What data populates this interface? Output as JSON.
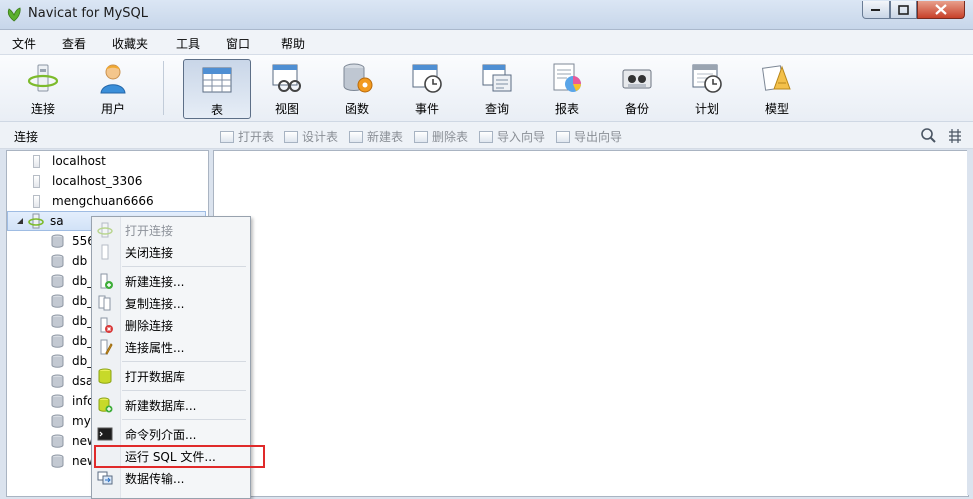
{
  "window": {
    "title": "Navicat for MySQL"
  },
  "menu": [
    "文件",
    "查看",
    "收藏夹",
    "工具",
    "窗口",
    "帮助"
  ],
  "toolbar": {
    "items": [
      {
        "label": "连接",
        "icon": "connection-icon"
      },
      {
        "label": "用户",
        "icon": "user-icon"
      },
      {
        "label": "表",
        "icon": "table-icon",
        "active": true
      },
      {
        "label": "视图",
        "icon": "view-icon"
      },
      {
        "label": "函数",
        "icon": "function-icon"
      },
      {
        "label": "事件",
        "icon": "event-icon"
      },
      {
        "label": "查询",
        "icon": "query-icon"
      },
      {
        "label": "报表",
        "icon": "report-icon"
      },
      {
        "label": "备份",
        "icon": "backup-icon"
      },
      {
        "label": "计划",
        "icon": "schedule-icon"
      },
      {
        "label": "模型",
        "icon": "model-icon"
      }
    ]
  },
  "subbar": {
    "connections_label": "连接",
    "object_actions": [
      "打开表",
      "设计表",
      "新建表",
      "删除表",
      "导入向导",
      "导出向导"
    ]
  },
  "tree": {
    "connections": [
      "localhost",
      "localhost_3306",
      "mengchuan6666",
      "sa"
    ],
    "databases": [
      "556",
      "db",
      "db_",
      "db_",
      "db_",
      "db_",
      "db_",
      "dsa",
      "info",
      "mys",
      "new",
      "new"
    ]
  },
  "context_menu": {
    "items": [
      {
        "label": "打开连接",
        "disabled": true
      },
      {
        "label": "关闭连接"
      },
      {
        "label": "新建连接..."
      },
      {
        "label": "复制连接..."
      },
      {
        "label": "删除连接"
      },
      {
        "label": "连接属性..."
      },
      {
        "label": "打开数据库"
      },
      {
        "label": "新建数据库..."
      },
      {
        "label": "命令列介面..."
      },
      {
        "label": "运行 SQL 文件..."
      },
      {
        "label": "数据传输..."
      }
    ]
  },
  "colors": {
    "highlight": "#e02a2a",
    "selection": "#d2e2f7"
  }
}
